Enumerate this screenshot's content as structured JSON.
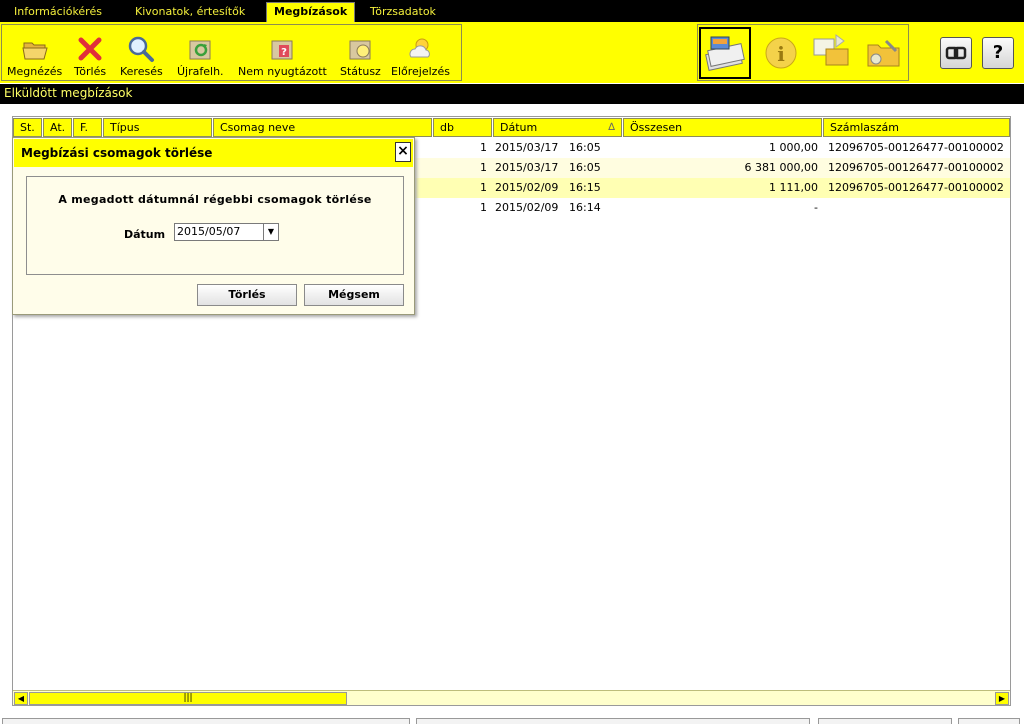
{
  "menu": [
    {
      "label": "Információkérés",
      "active": false
    },
    {
      "label": "Kivonatok, értesítők",
      "active": false
    },
    {
      "label": "Megbízások",
      "active": true
    },
    {
      "label": "Törzsadatok",
      "active": false
    }
  ],
  "toolbar": {
    "view": "Megnézés",
    "delete": "Törlés",
    "search": "Keresés",
    "refresh": "Újrafelh.",
    "unconfirmed": "Nem nyugtázott",
    "status": "Státusz",
    "forecast": "Előrejelzés"
  },
  "right_buttons": {
    "link_icon": "chain-link-icon",
    "help": "?"
  },
  "section": {
    "title": "Elküldött megbízások"
  },
  "table": {
    "headers": {
      "st": "St.",
      "at": "At.",
      "f": "F.",
      "type": "Típus",
      "package_name": "Csomag neve",
      "db": "db",
      "date": "Dátum",
      "total": "Összesen",
      "account": "Számlaszám"
    },
    "sort_indicator": "∆",
    "rows": [
      {
        "db": "1",
        "date": "2015/03/17",
        "time": "16:05",
        "total": "1 000,00",
        "account": "12096705-00126477-00100002"
      },
      {
        "db": "1",
        "date": "2015/03/17",
        "time": "16:05",
        "total": "6 381 000,00",
        "account": "12096705-00126477-00100002"
      },
      {
        "db": "1",
        "date": "2015/02/09",
        "time": "16:15",
        "total": "1 111,00",
        "account": "12096705-00126477-00100002"
      },
      {
        "db": "1",
        "date": "2015/02/09",
        "time": "16:14",
        "total": "-",
        "account": ""
      }
    ]
  },
  "dialog": {
    "title": "Megbízási csomagok törlése",
    "close": "×",
    "heading": "A megadott dátumnál régebbi csomagok törlése",
    "date_label": "Dátum",
    "date_value": "2015/05/07",
    "delete_button": "Törlés",
    "cancel_button": "Mégsem"
  },
  "colors": {
    "accent": "#ffff00",
    "menubar": "#000000",
    "menu_text": "#f4ef3c",
    "row_alt": "#fffde0",
    "row_selected": "#ffffb3"
  }
}
